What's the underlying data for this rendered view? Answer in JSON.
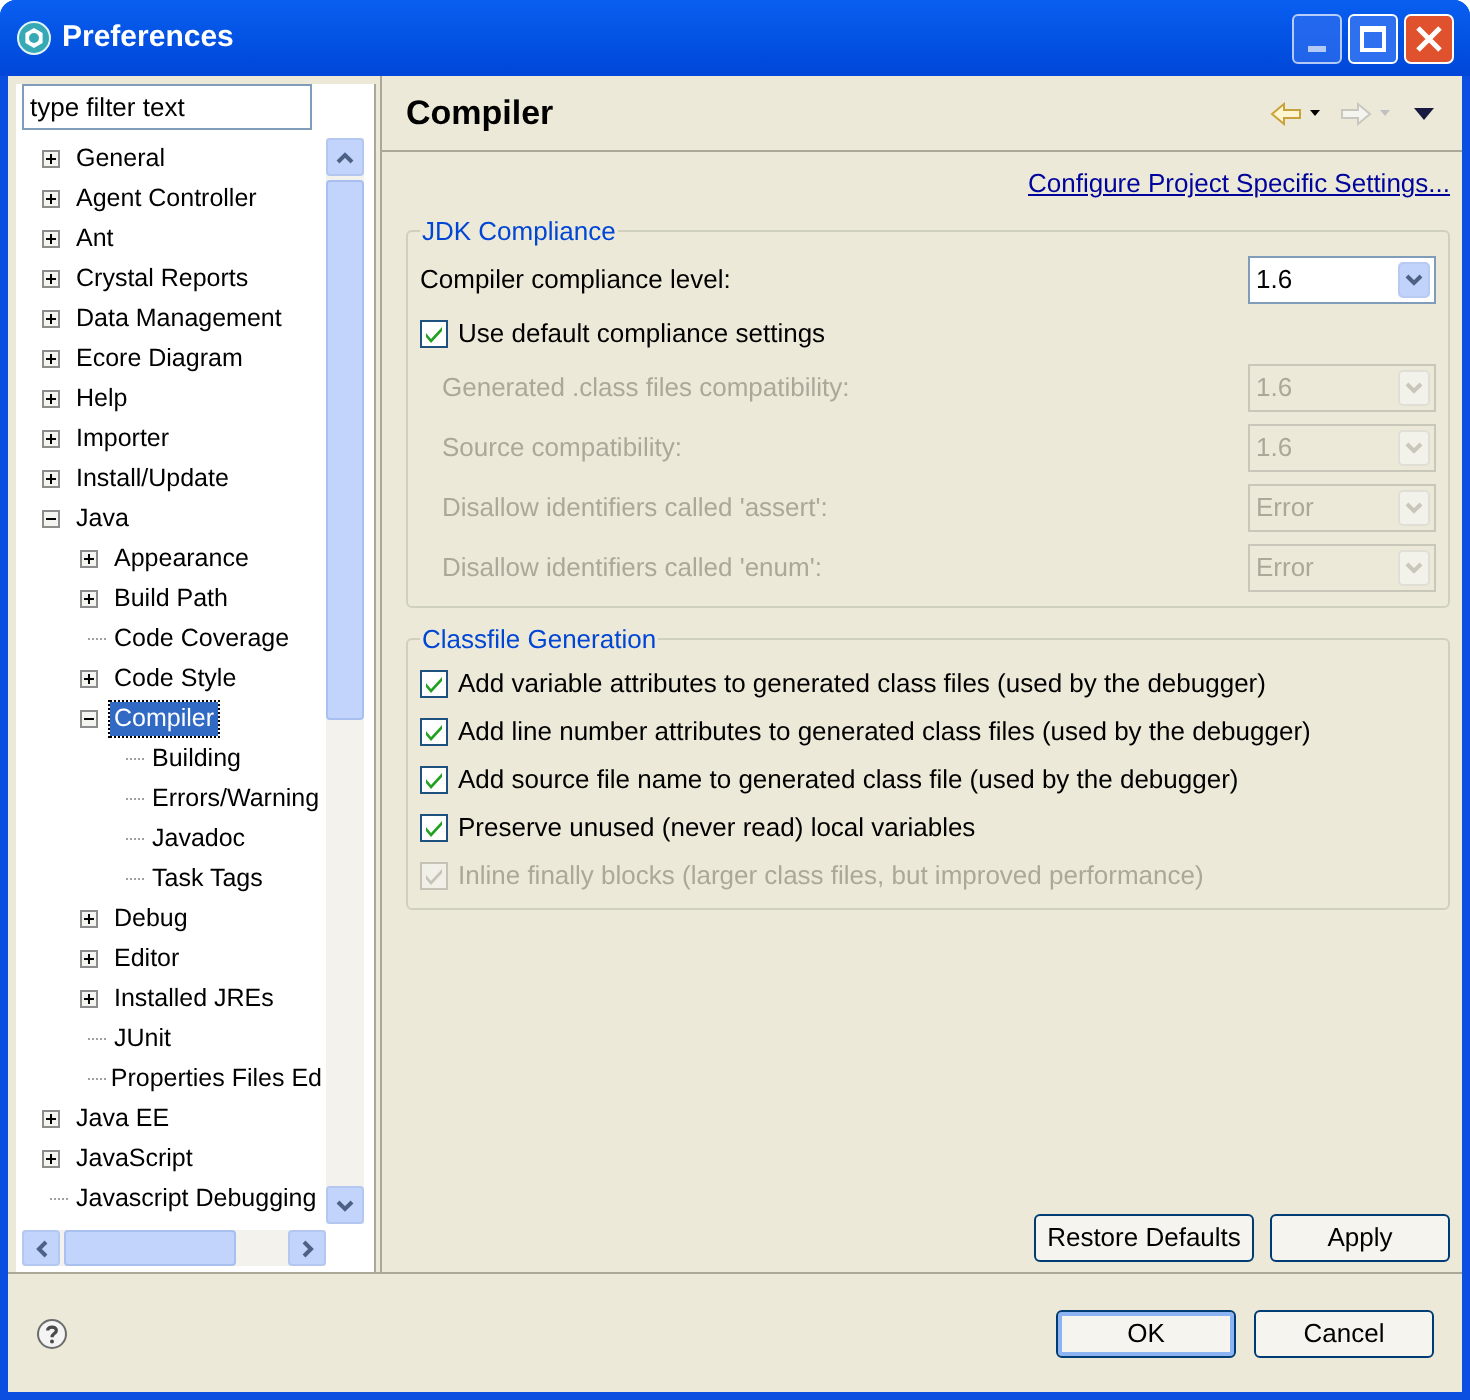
{
  "window": {
    "title": "Preferences"
  },
  "filter": {
    "value": "type filter text"
  },
  "tree": [
    {
      "label": "General",
      "kind": "branch",
      "expanded": false,
      "selected": false
    },
    {
      "label": "Agent Controller",
      "kind": "branch",
      "expanded": false,
      "selected": false
    },
    {
      "label": "Ant",
      "kind": "branch",
      "expanded": false,
      "selected": false
    },
    {
      "label": "Crystal Reports",
      "kind": "branch",
      "expanded": false,
      "selected": false
    },
    {
      "label": "Data Management",
      "kind": "branch",
      "expanded": false,
      "selected": false
    },
    {
      "label": "Ecore Diagram",
      "kind": "branch",
      "expanded": false,
      "selected": false
    },
    {
      "label": "Help",
      "kind": "branch",
      "expanded": false,
      "selected": false
    },
    {
      "label": "Importer",
      "kind": "branch",
      "expanded": false,
      "selected": false
    },
    {
      "label": "Install/Update",
      "kind": "branch",
      "expanded": false,
      "selected": false
    },
    {
      "label": "Java",
      "kind": "branch",
      "expanded": true,
      "selected": false,
      "children": [
        {
          "label": "Appearance",
          "kind": "branch",
          "expanded": false,
          "selected": false
        },
        {
          "label": "Build Path",
          "kind": "branch",
          "expanded": false,
          "selected": false
        },
        {
          "label": "Code Coverage",
          "kind": "leaf",
          "selected": false
        },
        {
          "label": "Code Style",
          "kind": "branch",
          "expanded": false,
          "selected": false
        },
        {
          "label": "Compiler",
          "kind": "branch",
          "expanded": true,
          "selected": true,
          "children": [
            {
              "label": "Building",
              "kind": "leaf",
              "selected": false
            },
            {
              "label": "Errors/Warning",
              "kind": "leaf",
              "selected": false
            },
            {
              "label": "Javadoc",
              "kind": "leaf",
              "selected": false
            },
            {
              "label": "Task Tags",
              "kind": "leaf",
              "selected": false
            }
          ]
        },
        {
          "label": "Debug",
          "kind": "branch",
          "expanded": false,
          "selected": false
        },
        {
          "label": "Editor",
          "kind": "branch",
          "expanded": false,
          "selected": false
        },
        {
          "label": "Installed JREs",
          "kind": "branch",
          "expanded": false,
          "selected": false
        },
        {
          "label": "JUnit",
          "kind": "leaf",
          "selected": false
        },
        {
          "label": "Properties Files Ed",
          "kind": "leaf",
          "selected": false
        }
      ]
    },
    {
      "label": "Java EE",
      "kind": "branch",
      "expanded": false,
      "selected": false
    },
    {
      "label": "JavaScript",
      "kind": "branch",
      "expanded": false,
      "selected": false
    },
    {
      "label": "Javascript Debugging",
      "kind": "leaf",
      "selected": false
    }
  ],
  "page": {
    "title": "Compiler",
    "link": "Configure Project Specific Settings...",
    "groups": [
      {
        "title": "JDK Compliance",
        "rows": [
          {
            "kind": "combo",
            "label": "Compiler compliance level:",
            "value": "1.6",
            "disabled": false
          },
          {
            "kind": "checkbox",
            "label": "Use default compliance settings",
            "checked": true,
            "disabled": false
          },
          {
            "kind": "combo",
            "label": "Generated .class files compatibility:",
            "value": "1.6",
            "disabled": true
          },
          {
            "kind": "combo",
            "label": "Source compatibility:",
            "value": "1.6",
            "disabled": true
          },
          {
            "kind": "combo",
            "label": "Disallow identifiers called 'assert':",
            "value": "Error",
            "disabled": true
          },
          {
            "kind": "combo",
            "label": "Disallow identifiers called 'enum':",
            "value": "Error",
            "disabled": true
          }
        ]
      },
      {
        "title": "Classfile Generation",
        "rows": [
          {
            "kind": "checkbox",
            "label": "Add variable attributes to generated class files (used by the debugger)",
            "checked": true,
            "disabled": false
          },
          {
            "kind": "checkbox",
            "label": "Add line number attributes to generated class files (used by the debugger)",
            "checked": true,
            "disabled": false
          },
          {
            "kind": "checkbox",
            "label": "Add source file name to generated class file (used by the debugger)",
            "checked": true,
            "disabled": false
          },
          {
            "kind": "checkbox",
            "label": "Preserve unused (never read) local variables",
            "checked": true,
            "disabled": false
          },
          {
            "kind": "checkbox",
            "label": "Inline finally blocks (larger class files, but improved performance)",
            "checked": true,
            "disabled": true
          }
        ]
      }
    ],
    "buttons": [
      "Restore Defaults",
      "Apply"
    ]
  },
  "footer_buttons": [
    {
      "label": "OK",
      "default": true
    },
    {
      "label": "Cancel",
      "default": false
    }
  ]
}
